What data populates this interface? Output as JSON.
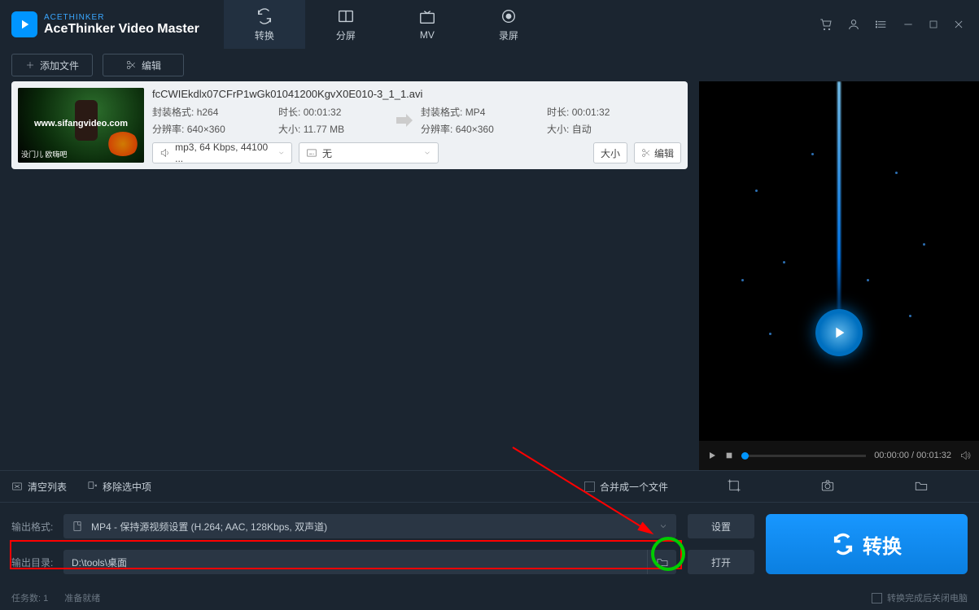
{
  "brand": {
    "top": "ACETHINKER",
    "main": "AceThinker Video Master"
  },
  "tabs": {
    "convert": "转换",
    "split": "分屏",
    "mv": "MV",
    "record": "录屏"
  },
  "toolbar": {
    "add_file": "添加文件",
    "edit": "编辑"
  },
  "file": {
    "name": "fcCWIEkdlx07CFrP1wGk01041200KgvX0E010-3_1_1.avi",
    "thumb_watermark": "www.sifangvideo.com",
    "thumb_caption": "没门儿 欧嗨吧",
    "src": {
      "encap_label": "封装格式:",
      "encap": "h264",
      "dur_label": "时长:",
      "dur": "00:01:32",
      "res_label": "分辨率:",
      "res": "640×360",
      "size_label": "大小:",
      "size": "11.77 MB"
    },
    "dst": {
      "encap_label": "封装格式:",
      "encap": "MP4",
      "dur_label": "时长:",
      "dur": "00:01:32",
      "res_label": "分辨率:",
      "res": "640×360",
      "size_label": "大小:",
      "size": "自动"
    },
    "audio_select": "mp3, 64 Kbps, 44100 ...",
    "subtitle_select": "无",
    "size_btn": "大小",
    "edit_btn": "编辑"
  },
  "player": {
    "time": "00:00:00 / 00:01:32"
  },
  "midbar": {
    "clear_list": "清空列表",
    "remove_selected": "移除选中项",
    "merge": "合并成一个文件"
  },
  "output": {
    "format_label": "输出格式:",
    "format_value": "MP4 - 保持源视频设置 (H.264; AAC, 128Kbps, 双声道)",
    "dir_label": "输出目录:",
    "dir_value": "D:\\tools\\桌面",
    "settings_btn": "设置",
    "open_btn": "打开",
    "convert_btn": "转换"
  },
  "status": {
    "tasks_label": "任务数:",
    "tasks": "1",
    "ready": "准备就绪",
    "shutdown": "转换完成后关闭电脑"
  }
}
